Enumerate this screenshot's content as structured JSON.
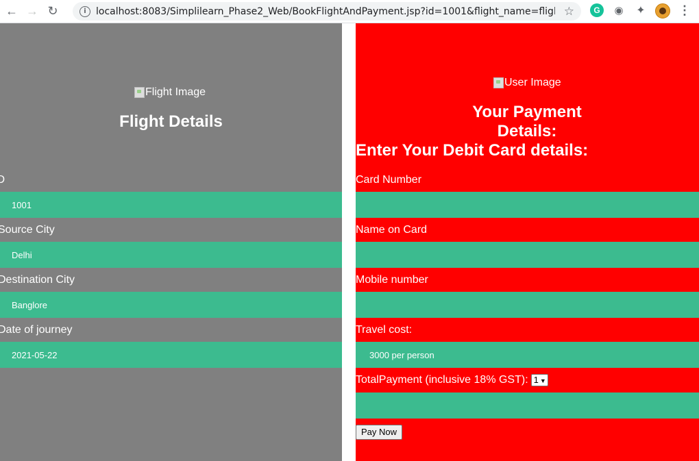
{
  "browser": {
    "url": "localhost:8083/Simplilearn_Phase2_Web/BookFlightAndPayment.jsp?id=1001&flight_name=flight_name&...",
    "icons": [
      "back-arrow-icon",
      "forward-arrow-icon",
      "reload-icon",
      "info-icon",
      "star-icon",
      "grammarly-icon",
      "camera-icon",
      "puzzle-icon",
      "profile-avatar",
      "kebab-menu-icon"
    ],
    "grammarly_letter": "G"
  },
  "left": {
    "image_alt": "Flight Image",
    "title": "Flight Details",
    "fields": [
      {
        "label": "ID",
        "value": "1001"
      },
      {
        "label": "Source City",
        "value": "Delhi"
      },
      {
        "label": "Destination City",
        "value": "Banglore"
      },
      {
        "label": "Date of journey",
        "value": "2021-05-22"
      }
    ]
  },
  "right": {
    "image_alt": "User Image",
    "title": "Your Payment Details:",
    "subtitle": "Enter Your Debit Card details:",
    "card_number_label": "Card Number",
    "card_number_value": "",
    "name_label": "Name on Card",
    "name_value": "",
    "mobile_label": "Mobile number",
    "mobile_value": "",
    "travel_cost_label": "Travel cost:",
    "travel_cost_value": "3000 per person",
    "total_label": "TotalPayment (inclusive 18% GST):",
    "quantity_selected": "1",
    "total_value": "",
    "pay_button": "Pay Now"
  },
  "colors": {
    "left_bg": "#808080",
    "right_bg": "#ff0000",
    "field_bg": "#3cbb8f"
  }
}
